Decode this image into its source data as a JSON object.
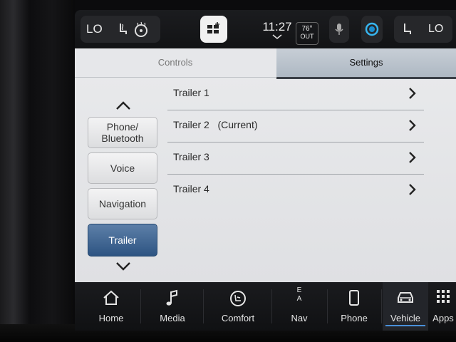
{
  "status_bar": {
    "left_temp": "LO",
    "time": "11:27",
    "outside_temp_value": "76°",
    "outside_temp_label": "OUT",
    "right_temp": "LO"
  },
  "tabs": [
    {
      "label": "Controls",
      "active": false
    },
    {
      "label": "Settings",
      "active": true
    }
  ],
  "sidebar": {
    "items": [
      {
        "label": "Phone/\nBluetooth",
        "active": false
      },
      {
        "label": "Voice",
        "active": false
      },
      {
        "label": "Navigation",
        "active": false
      },
      {
        "label": "Trailer",
        "active": true
      }
    ]
  },
  "trailer_list": [
    {
      "label": "Trailer 1"
    },
    {
      "label": "Trailer 2   (Current)"
    },
    {
      "label": "Trailer 3"
    },
    {
      "label": "Trailer 4"
    }
  ],
  "bottom_nav": [
    {
      "label": "Home",
      "icon": "home-icon"
    },
    {
      "label": "Media",
      "icon": "music-note-icon"
    },
    {
      "label": "Comfort",
      "icon": "comfort-icon"
    },
    {
      "label": "Nav",
      "icon": "compass-icon",
      "letters": [
        "E",
        "A"
      ]
    },
    {
      "label": "Phone",
      "icon": "phone-icon"
    },
    {
      "label": "Vehicle",
      "icon": "vehicle-icon",
      "active": true
    },
    {
      "label": "Apps",
      "icon": "apps-grid-icon"
    }
  ],
  "colors": {
    "accent": "#2d5482",
    "active_tab": "#aeb8c3",
    "nav_active_underline": "#4a90d9"
  }
}
